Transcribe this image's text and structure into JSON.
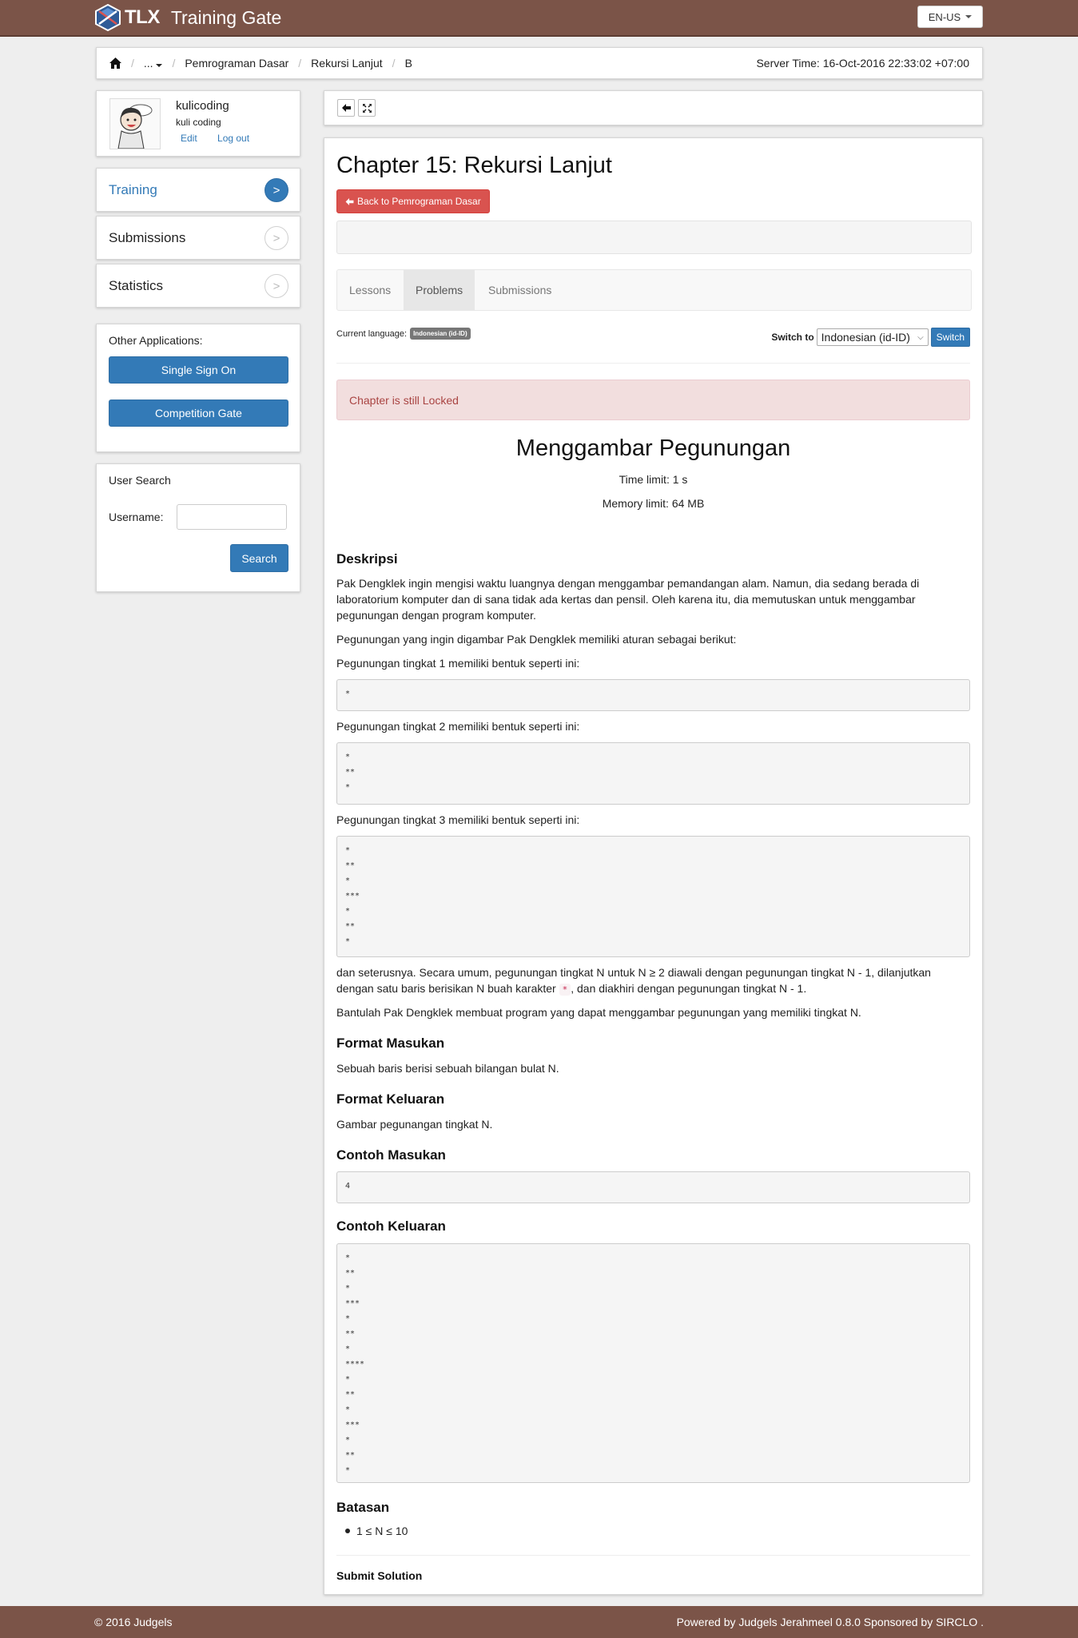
{
  "header": {
    "logo_text": "TLX",
    "app_name": "Training Gate",
    "language": "EN-US"
  },
  "breadcrumb": {
    "items": [
      "...",
      "Pemrograman Dasar",
      "Rekursi Lanjut",
      "B"
    ],
    "server_time": "Server Time: 16-Oct-2016 22:33:02 +07:00"
  },
  "profile": {
    "username": "kulicoding",
    "fullname": "kuli coding",
    "edit": "Edit",
    "logout": "Log out"
  },
  "sidebar": {
    "items": [
      {
        "label": "Training",
        "arrow": ">"
      },
      {
        "label": "Submissions",
        "arrow": ">"
      },
      {
        "label": "Statistics",
        "arrow": ">"
      }
    ]
  },
  "apps": {
    "title": "Other Applications:",
    "sso": "Single Sign On",
    "competition": "Competition Gate"
  },
  "user_search": {
    "title": "User Search",
    "label": "Username:",
    "value": "",
    "button": "Search"
  },
  "chapter": {
    "title": "Chapter 15: Rekursi Lanjut",
    "back": "Back to Pemrograman Dasar",
    "tabs": [
      "Lessons",
      "Problems",
      "Submissions"
    ],
    "current_language_label": "Current language:",
    "current_language": "Indonesian (id-ID)",
    "switch_to_label": "Switch to",
    "switch_select": "Indonesian (id-ID)",
    "switch_button": "Switch",
    "alert": "Chapter is still Locked"
  },
  "problem": {
    "title": "Menggambar Pegunungan",
    "time_limit": "Time limit: 1 s",
    "memory_limit": "Memory limit: 64 MB",
    "deskripsi_heading": "Deskripsi",
    "p1": "Pak Dengklek ingin mengisi waktu luangnya dengan menggambar pemandangan alam. Namun, dia sedang berada di laboratorium komputer dan di sana tidak ada kertas dan pensil. Oleh karena itu, dia memutuskan untuk menggambar pegunungan dengan program komputer.",
    "p2": "Pegunungan yang ingin digambar Pak Dengklek memiliki aturan sebagai berikut:",
    "p3": "Pegunungan tingkat 1 memiliki bentuk seperti ini:",
    "pre1": "*",
    "p4": "Pegunungan tingkat 2 memiliki bentuk seperti ini:",
    "pre2": "*\n**\n*",
    "p5": "Pegunungan tingkat 3 memiliki bentuk seperti ini:",
    "pre3": "*\n**\n*\n***\n*\n**\n*",
    "p6a": "dan seterusnya. Secara umum, pegunungan tingkat N untuk N ≥ 2 diawali dengan pegunungan tingkat N - 1, dilanjutkan dengan satu baris berisikan N buah karakter ",
    "p6code": "*",
    "p6b": ", dan diakhiri dengan pegunungan tingkat N - 1.",
    "p7": "Bantulah Pak Dengklek membuat program yang dapat menggambar pegunungan yang memiliki tingkat N.",
    "format_masukan_heading": "Format Masukan",
    "format_masukan": "Sebuah baris berisi sebuah bilangan bulat N.",
    "format_keluaran_heading": "Format Keluaran",
    "format_keluaran": "Gambar pegunangan tingkat N.",
    "contoh_masukan_heading": "Contoh Masukan",
    "contoh_masukan": "4",
    "contoh_keluaran_heading": "Contoh Keluaran",
    "contoh_keluaran": "*\n**\n*\n***\n*\n**\n*\n****\n*\n**\n*\n***\n*\n**\n*",
    "batasan_heading": "Batasan",
    "batasan_item": "1 ≤ N ≤ 10",
    "submit_heading": "Submit Solution"
  },
  "footer": {
    "left": "© 2016 Judgels",
    "right": "Powered by Judgels Jerahmeel 0.8.0 Sponsored by SIRCLO ."
  },
  "colors": {
    "brown": "#7b5448",
    "primary": "#337ab7",
    "danger": "#d9534f"
  }
}
